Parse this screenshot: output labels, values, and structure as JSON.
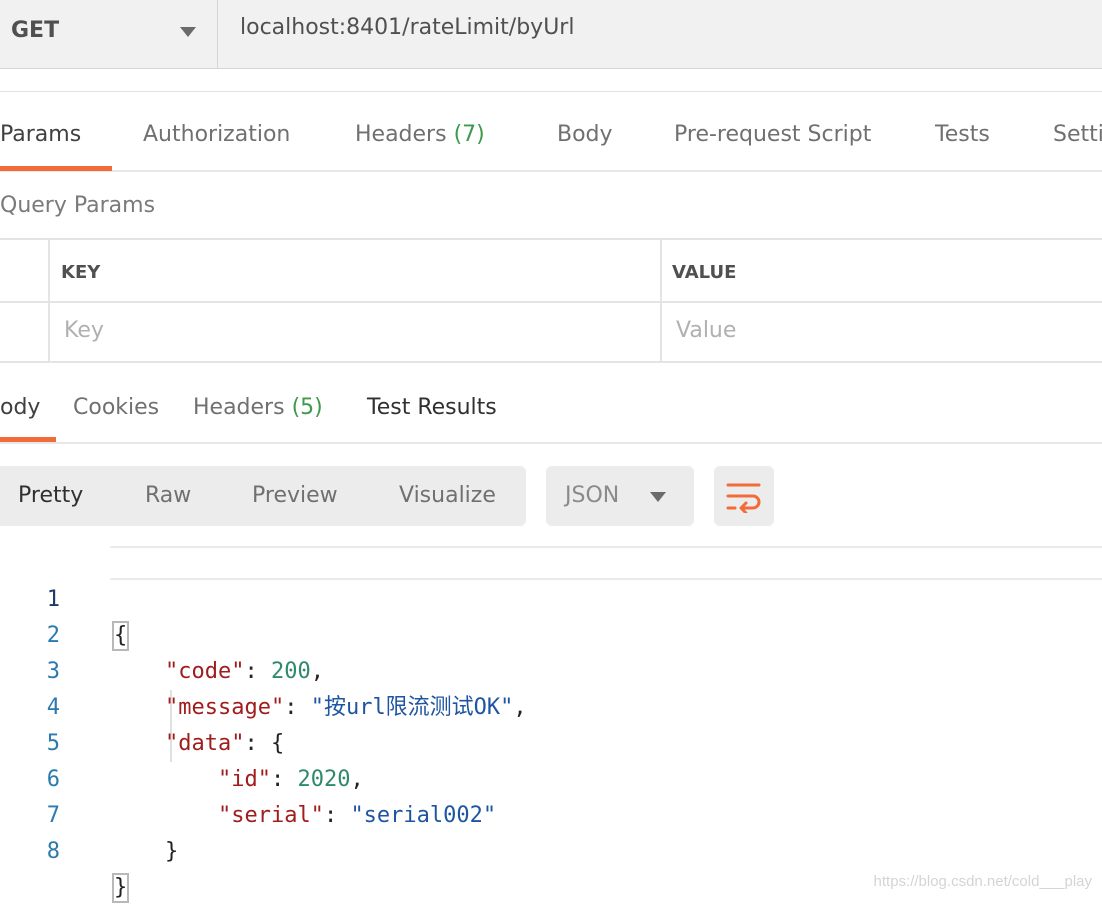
{
  "request": {
    "method": "GET",
    "url": "localhost:8401/rateLimit/byUrl"
  },
  "request_tabs": [
    {
      "label": "Params",
      "count": ""
    },
    {
      "label": "Authorization",
      "count": ""
    },
    {
      "label": "Headers",
      "count": "(7)"
    },
    {
      "label": "Body",
      "count": ""
    },
    {
      "label": "Pre-request Script",
      "count": ""
    },
    {
      "label": "Tests",
      "count": ""
    },
    {
      "label": "Setti",
      "count": ""
    }
  ],
  "query_params": {
    "title": "Query Params",
    "key_header": "KEY",
    "value_header": "VALUE",
    "key_placeholder": "Key",
    "value_placeholder": "Value"
  },
  "response_tabs": [
    {
      "label": "ody",
      "count": ""
    },
    {
      "label": "Cookies",
      "count": ""
    },
    {
      "label": "Headers",
      "count": "(5)"
    },
    {
      "label": "Test Results",
      "count": ""
    }
  ],
  "view_modes": [
    "Pretty",
    "Raw",
    "Preview",
    "Visualize"
  ],
  "format": "JSON",
  "colors": {
    "accent": "#f26b3a",
    "count": "#3f9a4e",
    "json_key": "#a11d1d",
    "json_string": "#1f55a0",
    "json_number": "#2f8a6a"
  },
  "code": {
    "line_numbers": [
      "1",
      "2",
      "3",
      "4",
      "5",
      "6",
      "7",
      "8"
    ],
    "open_brace": "{",
    "close_brace": "}",
    "code_key": "\"code\"",
    "code_value": "200",
    "message_key": "\"message\"",
    "message_value": "\"按url限流测试OK\"",
    "data_key": "\"data\"",
    "id_key": "\"id\"",
    "id_value": "2020",
    "serial_key": "\"serial\"",
    "serial_value": "\"serial002\""
  },
  "watermark": "https://blog.csdn.net/cold___play"
}
